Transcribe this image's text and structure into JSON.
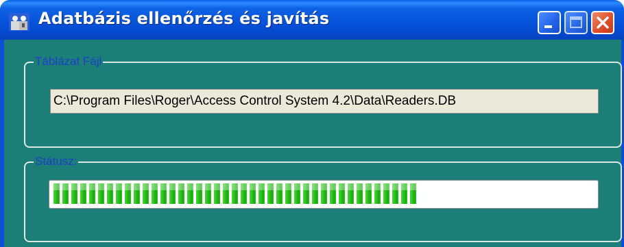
{
  "window": {
    "title": "Adatbázis ellenőrzés és javítás",
    "controls": [
      "minimize",
      "maximize",
      "close"
    ]
  },
  "file_group": {
    "legend": "Táblázat Fájl",
    "path_value": "C:\\Program Files\\Roger\\Access Control System 4.2\\Data\\Readers.DB"
  },
  "status_group": {
    "legend": "Státusz:",
    "progress_fraction": 0.68
  },
  "colors": {
    "titlebar": "#0551d8",
    "client_background": "#1b7f78",
    "legend_text": "#1f3ec9",
    "progress_green": "#27c01a",
    "close_button": "#e0502b"
  },
  "icons": {
    "app": "users-icon",
    "minimize": "minimize-icon",
    "maximize": "maximize-icon",
    "close": "close-icon"
  }
}
